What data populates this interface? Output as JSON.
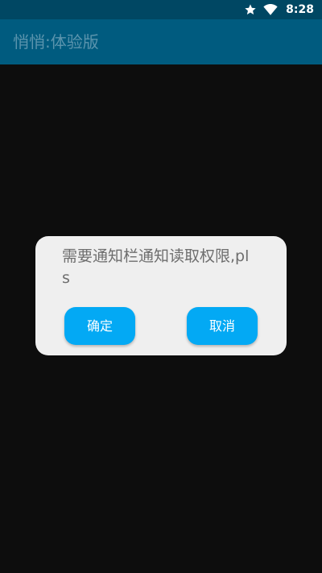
{
  "status_bar": {
    "time": "8:28",
    "icons": [
      "star-icon",
      "wifi-icon"
    ]
  },
  "app_bar": {
    "title": "悄悄:体验版"
  },
  "dialog": {
    "message": "需要通知栏通知读取权限,pls",
    "confirm_label": "确定",
    "cancel_label": "取消"
  },
  "colors": {
    "status_bar": "#004763",
    "app_bar": "#005b7f",
    "title_text": "#5b94ad",
    "background": "#0d0d0d",
    "dialog_bg": "#efefef",
    "button": "#03a9f4",
    "message_text": "#6e6e6e"
  }
}
